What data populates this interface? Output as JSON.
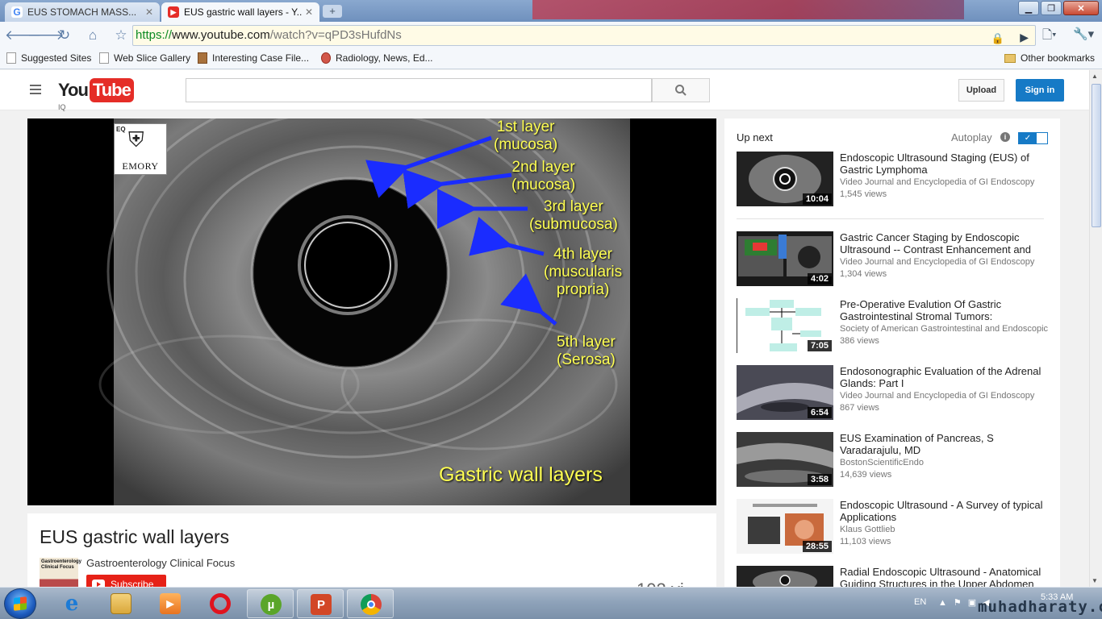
{
  "browser": {
    "tabs": [
      {
        "title": "EUS STOMACH MASS...",
        "favicon": "google-icon",
        "active": false
      },
      {
        "title": "EUS gastric wall layers - Y...",
        "favicon": "youtube-icon",
        "active": true
      }
    ],
    "address": {
      "scheme": "https://",
      "host": "www.youtube.com",
      "path": "/watch?v=qPD3sHufdNs"
    },
    "bookmarks": [
      {
        "label": "Suggested Sites",
        "icon": "page-icon"
      },
      {
        "label": "Web Slice Gallery",
        "icon": "page-icon"
      },
      {
        "label": "Interesting Case File...",
        "icon": "image-icon"
      },
      {
        "label": "Radiology, News, Ed...",
        "icon": "radiology-icon"
      }
    ],
    "other_bookmarks": "Other bookmarks"
  },
  "youtube": {
    "logo_you": "You",
    "logo_tube": "Tube",
    "country": "IQ",
    "search_placeholder": "",
    "upload_label": "Upload",
    "signin_label": "Sign in",
    "brand_color": "#e52d27",
    "accent_color": "#167ac6"
  },
  "video": {
    "watermark": "EMORY",
    "watermark_corner": "EQ",
    "labels": [
      {
        "line1": "1st layer",
        "line2": "(mucosa)"
      },
      {
        "line1": "2nd layer",
        "line2": "(mucosa)"
      },
      {
        "line1": "3rd layer",
        "line2": "(submucosa)"
      },
      {
        "line1": "4th layer",
        "line2": "(muscularis",
        "line3": "propria)"
      },
      {
        "line1": "5th layer",
        "line2": "(Serosa)"
      }
    ],
    "caption": "Gastric wall layers",
    "title": "EUS gastric wall layers",
    "channel": "Gastroenterology Clinical Focus",
    "channel_thumb_text": "Gastroenterology Clinical Focus",
    "subscribe_label": "Subscribe",
    "views_partial": "102 vi"
  },
  "sidebar": {
    "up_next": "Up next",
    "autoplay": "Autoplay",
    "autoplay_on": true,
    "videos": [
      {
        "title": "Endoscopic Ultrasound Staging (EUS) of Gastric Lymphoma",
        "channel": "Video Journal and Encyclopedia of GI Endoscopy",
        "views": "1,545 views",
        "duration": "10:04"
      },
      {
        "title": "Gastric Cancer Staging by Endoscopic Ultrasound -- Contrast Enhancement and",
        "channel": "Video Journal and Encyclopedia of GI Endoscopy",
        "views": "1,304 views",
        "duration": "4:02"
      },
      {
        "title": "Pre-Operative Evalution Of Gastric Gastrointestinal Stromal Tumors:",
        "channel": "Society of American Gastrointestinal and Endoscopic",
        "views": "386 views",
        "duration": "7:05"
      },
      {
        "title": "Endosonographic Evaluation of the Adrenal Glands: Part I",
        "channel": "Video Journal and Encyclopedia of GI Endoscopy",
        "views": "867 views",
        "duration": "6:54"
      },
      {
        "title": "EUS Examination of Pancreas, S Varadarajulu, MD",
        "channel": "BostonScientificEndo",
        "views": "14,639 views",
        "duration": "3:58"
      },
      {
        "title": "Endoscopic Ultrasound - A Survey of typical Applications",
        "channel": "Klaus Gottlieb",
        "views": "11,103 views",
        "duration": "28:55"
      },
      {
        "title": "Radial Endoscopic Ultrasound - Anatomical Guiding Structures in the Upper Abdomen",
        "channel": "",
        "views": "",
        "duration": ""
      }
    ]
  },
  "taskbar": {
    "apps": [
      "internet-explorer-icon",
      "file-explorer-icon",
      "media-player-icon",
      "opera-icon",
      "utorrent-icon",
      "powerpoint-icon",
      "chrome-icon"
    ],
    "language": "EN",
    "time": "5:33 AM"
  },
  "site_watermark": "muhadharaty.com"
}
